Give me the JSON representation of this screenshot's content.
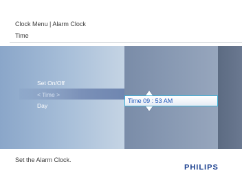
{
  "header": {
    "breadcrumb": "Clock Menu | Alarm Clock",
    "subtitle": "Time"
  },
  "menu": {
    "items": [
      "Set On/Off",
      "< Time >",
      "Day"
    ],
    "selected_index": 1
  },
  "time_field": {
    "label": "Time 09 : 53  AM",
    "up_icon": "arrow-up-icon",
    "down_icon": "arrow-down-icon"
  },
  "footer": {
    "help_text": "Set the Alarm Clock.",
    "brand": "PHILIPS"
  },
  "colors": {
    "accent": "#3fb2d8",
    "brand": "#1a3f8f",
    "time_text": "#1e56b8"
  }
}
